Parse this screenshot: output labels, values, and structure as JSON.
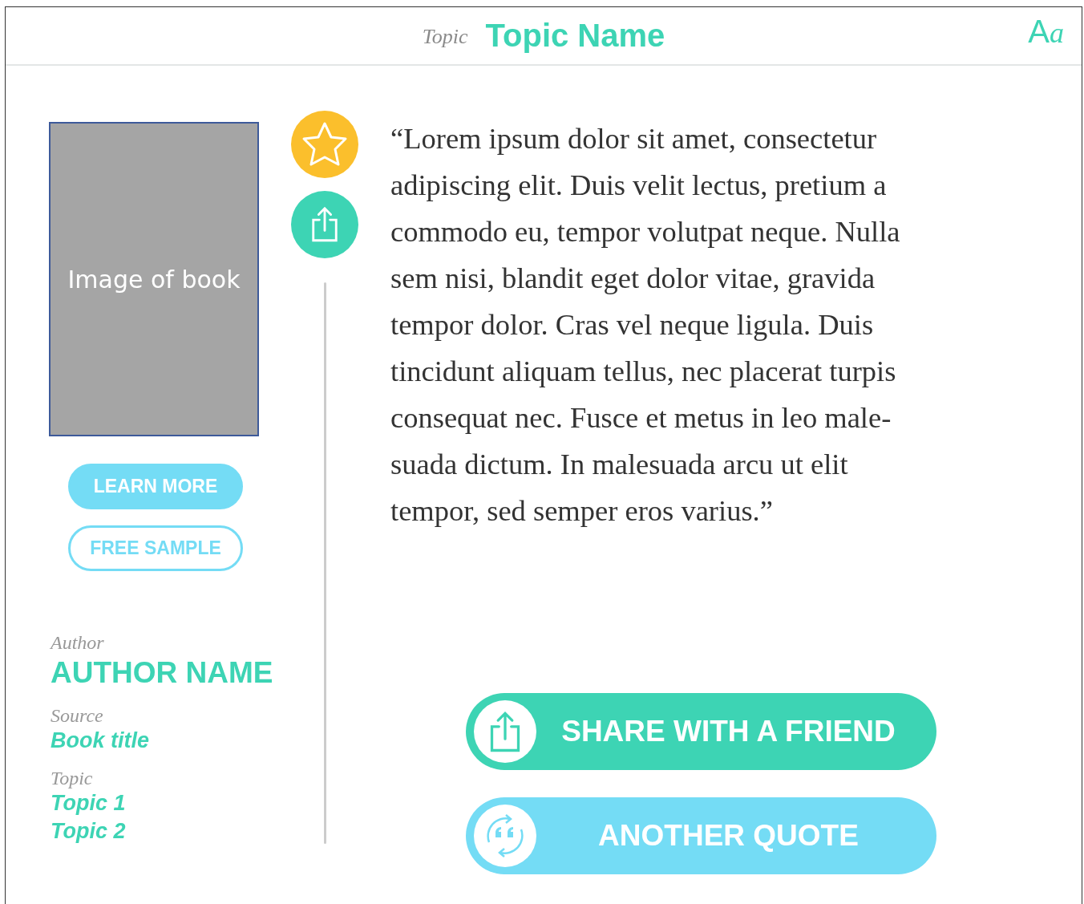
{
  "header": {
    "label": "Topic",
    "title": "Topic Name",
    "font_button": {
      "big": "A",
      "small": "a"
    }
  },
  "book": {
    "placeholder_text": "Image of book",
    "buttons": [
      {
        "label": "LEARN MORE",
        "kind": "filled"
      },
      {
        "label": "FREE SAMPLE",
        "kind": "outline"
      }
    ]
  },
  "details": [
    {
      "label": "Author",
      "values": [
        "AUTHOR NAME"
      ],
      "kind": "name"
    },
    {
      "label": "Source",
      "values": [
        "Book title"
      ],
      "kind": "link"
    },
    {
      "label": "Topic",
      "values": [
        "Topic 1",
        "Topic 2"
      ],
      "kind": "link"
    }
  ],
  "actions": {
    "favorite": {
      "selected": false
    }
  },
  "quote": "“Lorem ipsum dolor sit amet, consectetur\nadipiscing elit. Duis velit lectus, pretium a\ncommodo eu, tempor volutpat neque. Nulla\nsem nisi, blandit eget dolor vitae, gravida\ntempor dolor. Cras vel neque ligula. Duis\ntincidunt aliquam tellus, nec placerat turpis\nconsequat nec. Fusce et metus in leo male-\nsuada dictum. In malesuada arcu ut elit\ntempor, sed semper eros varius.”",
  "bottom_buttons": [
    {
      "label": "SHARE WITH A FRIEND",
      "kind": "share"
    },
    {
      "label": "ANOTHER QUOTE",
      "kind": "another"
    }
  ]
}
